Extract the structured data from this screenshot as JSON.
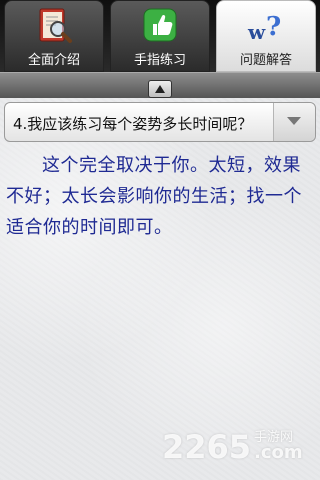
{
  "tabs": [
    {
      "label": "全面介绍",
      "icon": "book-search-icon"
    },
    {
      "label": "手指练习",
      "icon": "thumbs-up-icon"
    },
    {
      "label": "问题解答",
      "icon": "question-icon"
    }
  ],
  "active_tab": 2,
  "question": {
    "selected": "4.我应该练习每个姿势多长时间呢？"
  },
  "answer": "这个完全取决于你。太短，效果不好；太长会影响你的生活；找一个适合你的时间即可。",
  "watermark": {
    "number": "2265",
    "site_cn": "手游网",
    "domain": ".com"
  },
  "colors": {
    "answer_text": "#1f2a93",
    "tab_dark": "#2b2b2b",
    "tab_active": "#ffffff"
  }
}
